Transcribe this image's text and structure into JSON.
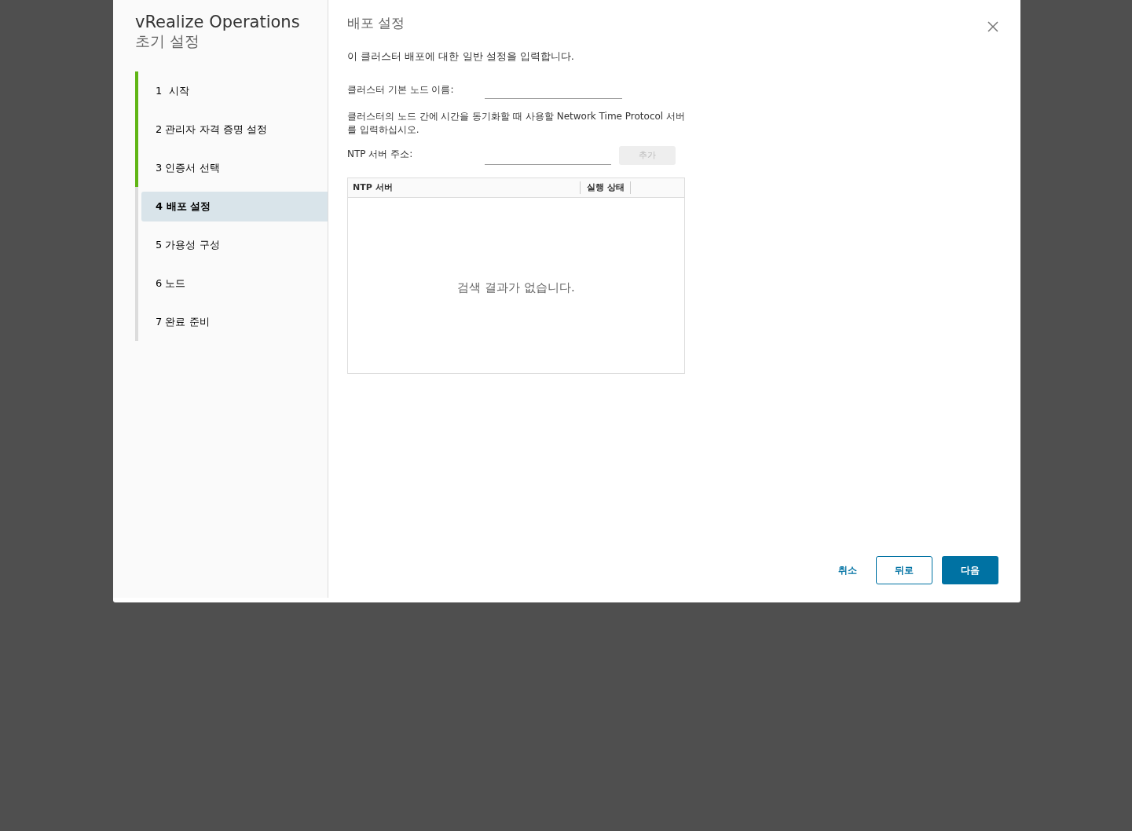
{
  "sidebar": {
    "title": "vRealize Operations",
    "subtitle": "초기 설정",
    "steps": [
      {
        "label": "1  시작",
        "done": true,
        "selected": false
      },
      {
        "label": "2 관리자 자격 증명 설정",
        "done": true,
        "selected": false
      },
      {
        "label": "3 인증서 선택",
        "done": true,
        "selected": false
      },
      {
        "label": "4 배포 설정",
        "done": false,
        "selected": true
      },
      {
        "label": "5 가용성 구성",
        "done": false,
        "selected": false
      },
      {
        "label": "6 노드",
        "done": false,
        "selected": false
      },
      {
        "label": "7 완료 준비",
        "done": false,
        "selected": false
      }
    ]
  },
  "page": {
    "title": "배포 설정",
    "intro": "이 클러스터 배포에 대한 일반 설정을 입력합니다.",
    "node_name_label": "클러스터 기본 노드 이름:",
    "ntp_help": "클러스터의 노드 간에 시간을 동기화할 때 사용할 Network Time Protocol 서버를 입력하십시오.",
    "ntp_label": "NTP 서버 주소:",
    "add_button": {
      "label": "추가",
      "disabled": true
    },
    "table": {
      "columns": [
        "NTP 서버",
        "실행 상태"
      ],
      "empty_message": "검색 결과가 없습니다."
    }
  },
  "buttons": [
    {
      "label": "취소",
      "kind": "link"
    },
    {
      "label": "뒤로",
      "kind": "outline"
    },
    {
      "label": "다음",
      "kind": "primary"
    }
  ]
}
